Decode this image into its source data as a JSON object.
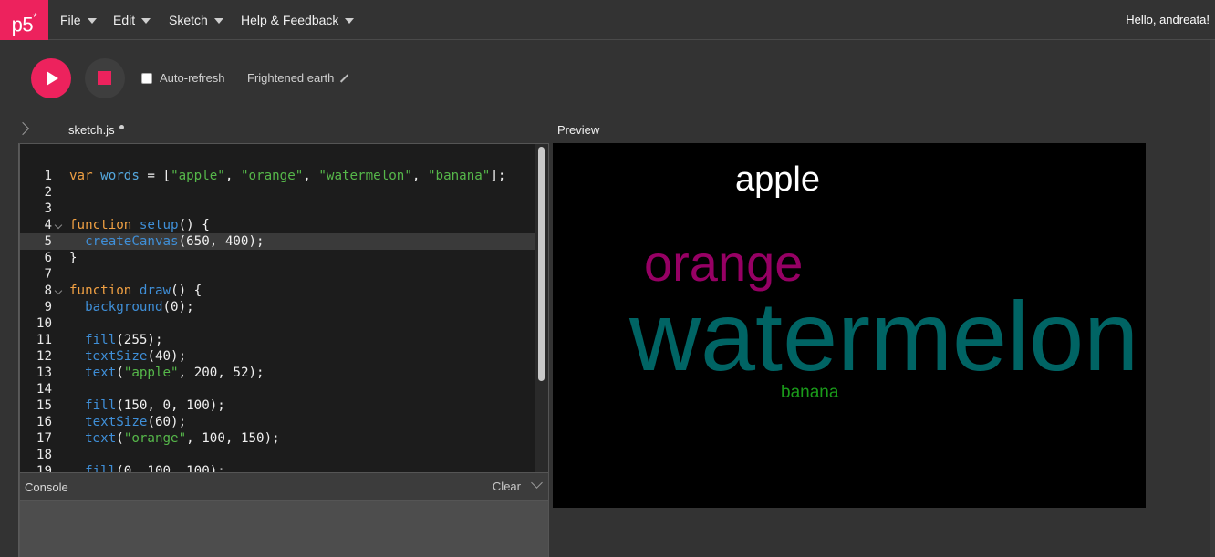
{
  "nav": {
    "logo": "p5",
    "logo_mark": "*",
    "menu": [
      {
        "label": "File"
      },
      {
        "label": "Edit"
      },
      {
        "label": "Sketch"
      },
      {
        "label": "Help & Feedback"
      }
    ],
    "greeting": "Hello, andreata!"
  },
  "toolbar": {
    "play_icon": "play-icon",
    "stop_icon": "stop-icon",
    "autorefresh_label": "Auto-refresh",
    "autorefresh_checked": false,
    "sketch_name": "Frightened earth",
    "edit_icon": "pencil-icon"
  },
  "editor": {
    "file_name": "sketch.js",
    "unsaved": true,
    "lines": [
      {
        "n": "1",
        "tokens": [
          [
            "kw",
            "var"
          ],
          [
            "",
            " "
          ],
          [
            "nm",
            "words"
          ],
          [
            "",
            " = ["
          ],
          [
            "str",
            "\"apple\""
          ],
          [
            "",
            ", "
          ],
          [
            "str",
            "\"orange\""
          ],
          [
            "",
            ", "
          ],
          [
            "str",
            "\"watermelon\""
          ],
          [
            "",
            ", "
          ],
          [
            "str",
            "\"banana\""
          ],
          [
            "",
            "];"
          ]
        ]
      },
      {
        "n": "2",
        "tokens": []
      },
      {
        "n": "3",
        "tokens": []
      },
      {
        "n": "4",
        "fold": true,
        "tokens": [
          [
            "kw",
            "function"
          ],
          [
            "",
            " "
          ],
          [
            "fn",
            "setup"
          ],
          [
            "",
            "() {"
          ]
        ]
      },
      {
        "n": "5",
        "active": true,
        "tokens": [
          [
            "",
            "  "
          ],
          [
            "fn",
            "createCanvas"
          ],
          [
            "",
            "(650, 400);"
          ]
        ]
      },
      {
        "n": "6",
        "tokens": [
          [
            "",
            "}"
          ]
        ]
      },
      {
        "n": "7",
        "tokens": []
      },
      {
        "n": "8",
        "fold": true,
        "tokens": [
          [
            "kw",
            "function"
          ],
          [
            "",
            " "
          ],
          [
            "fn",
            "draw"
          ],
          [
            "",
            "() {"
          ]
        ]
      },
      {
        "n": "9",
        "tokens": [
          [
            "",
            "  "
          ],
          [
            "fn",
            "background"
          ],
          [
            "",
            "(0);"
          ]
        ]
      },
      {
        "n": "10",
        "tokens": []
      },
      {
        "n": "11",
        "tokens": [
          [
            "",
            "  "
          ],
          [
            "fn",
            "fill"
          ],
          [
            "",
            "(255);"
          ]
        ]
      },
      {
        "n": "12",
        "tokens": [
          [
            "",
            "  "
          ],
          [
            "fn",
            "textSize"
          ],
          [
            "",
            "(40);"
          ]
        ]
      },
      {
        "n": "13",
        "tokens": [
          [
            "",
            "  "
          ],
          [
            "fn",
            "text"
          ],
          [
            "",
            "("
          ],
          [
            "str",
            "\"apple\""
          ],
          [
            "",
            ", 200, 52);"
          ]
        ]
      },
      {
        "n": "14",
        "tokens": []
      },
      {
        "n": "15",
        "tokens": [
          [
            "",
            "  "
          ],
          [
            "fn",
            "fill"
          ],
          [
            "",
            "(150, 0, 100);"
          ]
        ]
      },
      {
        "n": "16",
        "tokens": [
          [
            "",
            "  "
          ],
          [
            "fn",
            "textSize"
          ],
          [
            "",
            "(60);"
          ]
        ]
      },
      {
        "n": "17",
        "tokens": [
          [
            "",
            "  "
          ],
          [
            "fn",
            "text"
          ],
          [
            "",
            "("
          ],
          [
            "str",
            "\"orange\""
          ],
          [
            "",
            ", 100, 150);"
          ]
        ]
      },
      {
        "n": "18",
        "tokens": []
      },
      {
        "n": "19",
        "tokens": [
          [
            "",
            "  "
          ],
          [
            "fn",
            "fill"
          ],
          [
            "",
            "(0, 100, 100);"
          ]
        ]
      }
    ]
  },
  "console": {
    "title": "Console",
    "clear_label": "Clear",
    "collapse_icon": "chevron-down-icon"
  },
  "preview": {
    "label": "Preview",
    "words": [
      {
        "text": "apple",
        "color": "#ffffff"
      },
      {
        "text": "orange",
        "color": "#960064"
      },
      {
        "text": "watermelon",
        "color": "#006464"
      },
      {
        "text": "banana",
        "color": "#1a9a1a"
      }
    ]
  },
  "colors": {
    "brand": "#ed225d",
    "background": "#333333",
    "editor_bg": "#1c1c1c"
  }
}
